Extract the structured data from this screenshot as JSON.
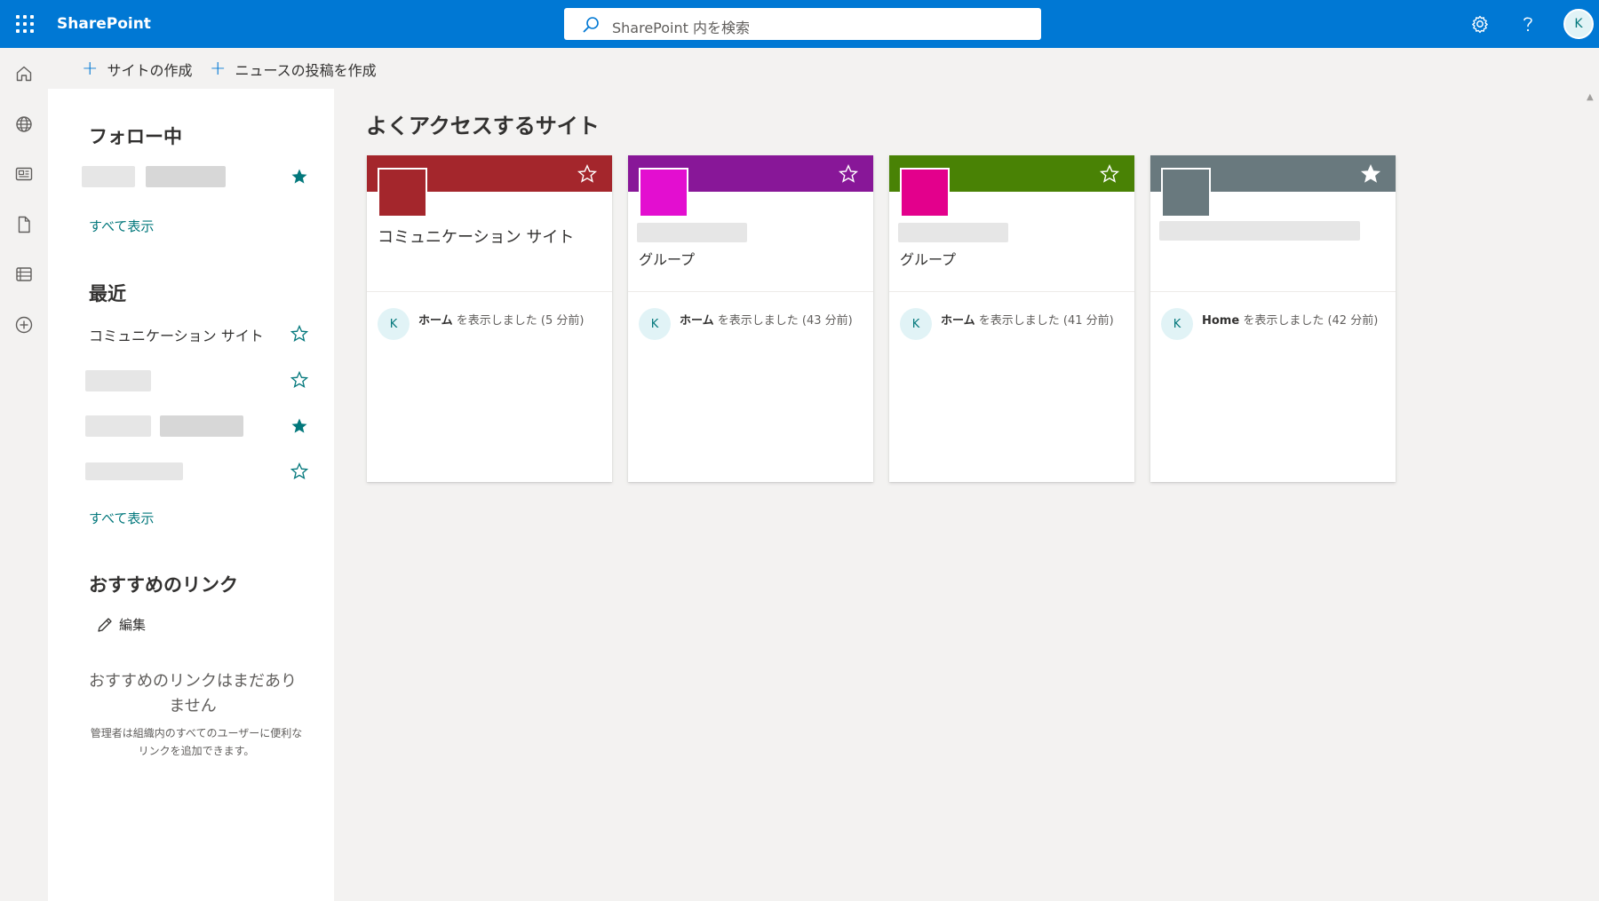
{
  "app": {
    "name": "SharePoint"
  },
  "search": {
    "placeholder": "SharePoint 内を検索"
  },
  "topbar": {
    "avatar_initial": "K",
    "icons": [
      "settings-icon",
      "help-icon"
    ]
  },
  "rail": {
    "items": [
      "home-icon",
      "globe-icon",
      "news-icon",
      "file-icon",
      "list-icon",
      "add-circle-icon"
    ]
  },
  "commands": {
    "create_site": "サイトの作成",
    "create_news": "ニュースの投稿を作成"
  },
  "following": {
    "title": "フォロー中",
    "show_all": "すべて表示"
  },
  "recent": {
    "title": "最近",
    "items": [
      "コミュニケーション サイト"
    ],
    "show_all": "すべて表示"
  },
  "links": {
    "title": "おすすめのリンク",
    "edit": "編集",
    "empty_title": "おすすめのリンクはまだありません",
    "empty_desc": "管理者は組織内のすべてのユーザーに便利なリンクを追加できます。"
  },
  "main": {
    "title": "よくアクセスするサイト",
    "cards": [
      {
        "name": "コミュニケーション サイト",
        "type": "",
        "banner_color": "#a4262c",
        "logo_color": "#a4262c",
        "starred": false,
        "avatar": "K",
        "activity_page": "ホーム",
        "activity_text": "を表示しました (5 分前)"
      },
      {
        "name": "",
        "type": "グループ",
        "banner_color": "#881798",
        "logo_color": "#e30ed0",
        "starred": false,
        "avatar": "K",
        "activity_page": "ホーム",
        "activity_text": "を表示しました (43 分前)"
      },
      {
        "name": "",
        "type": "グループ",
        "banner_color": "#498205",
        "logo_color": "#e3008c",
        "starred": false,
        "avatar": "K",
        "activity_page": "ホーム",
        "activity_text": "を表示しました (41 分前)"
      },
      {
        "name": "",
        "type": "",
        "banner_color": "#69797e",
        "logo_color": "#69797e",
        "starred": true,
        "avatar": "K",
        "activity_page": "Home",
        "activity_text": "を表示しました (42 分前)"
      }
    ]
  }
}
